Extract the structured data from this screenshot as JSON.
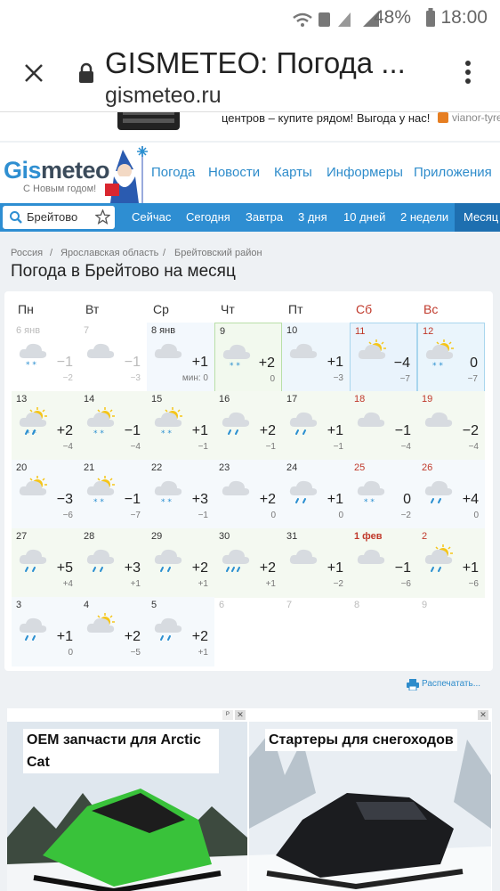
{
  "status_bar": {
    "battery": "48%",
    "time": "18:00"
  },
  "browser": {
    "title": "GISMETEO: Погода ...",
    "url": "gismeteo.ru"
  },
  "top_ad": {
    "text": "центров – купите рядом! Выгода у нас!",
    "brand": "vianor-tyre"
  },
  "header": {
    "logo_a": "Gis",
    "logo_b": "meteo",
    "logo_sub": "С Новым годом!",
    "nav": [
      "Погода",
      "Новости",
      "Карты",
      "Информеры",
      "Приложения"
    ]
  },
  "tabs": {
    "search_value": "Брейтово",
    "items": [
      "Сейчас",
      "Сегодня",
      "Завтра",
      "3 дня",
      "10 дней",
      "2 недели",
      "Месяц"
    ]
  },
  "breadcrumb": [
    "Россия",
    "Ярославская область",
    "Брейтовский район"
  ],
  "page_title": "Погода в Брейтово на месяц",
  "weekdays": [
    "Пн",
    "Вт",
    "Ср",
    "Чт",
    "Пт",
    "Сб",
    "Вс"
  ],
  "calendar": [
    {
      "date": "6 янв",
      "hi": "−1",
      "lo": "−2",
      "icon": "cloud-snow",
      "past": true
    },
    {
      "date": "7",
      "hi": "−1",
      "lo": "−3",
      "icon": "cloud",
      "past": true
    },
    {
      "date": "8 янв",
      "hi": "+1",
      "lo": "мин: 0",
      "icon": "cloud"
    },
    {
      "date": "9",
      "hi": "+2",
      "lo": "0",
      "icon": "cloud-snow"
    },
    {
      "date": "10",
      "hi": "+1",
      "lo": "−3",
      "icon": "cloud"
    },
    {
      "date": "11",
      "hi": "−4",
      "lo": "−7",
      "icon": "sun-cloud"
    },
    {
      "date": "12",
      "hi": "0",
      "lo": "−7",
      "icon": "sun-cloud-snow"
    },
    {
      "date": "13",
      "hi": "+2",
      "lo": "−4",
      "icon": "sun-cloud-snowrain"
    },
    {
      "date": "14",
      "hi": "−1",
      "lo": "−4",
      "icon": "sun-cloud-snow"
    },
    {
      "date": "15",
      "hi": "+1",
      "lo": "−1",
      "icon": "sun-cloud-snow"
    },
    {
      "date": "16",
      "hi": "+2",
      "lo": "−1",
      "icon": "cloud-rain"
    },
    {
      "date": "17",
      "hi": "+1",
      "lo": "−1",
      "icon": "cloud-rain"
    },
    {
      "date": "18",
      "hi": "−1",
      "lo": "−4",
      "icon": "cloud"
    },
    {
      "date": "19",
      "hi": "−2",
      "lo": "−4",
      "icon": "cloud"
    },
    {
      "date": "20",
      "hi": "−3",
      "lo": "−6",
      "icon": "sun-cloud"
    },
    {
      "date": "21",
      "hi": "−1",
      "lo": "−7",
      "icon": "sun-cloud-snow"
    },
    {
      "date": "22",
      "hi": "+3",
      "lo": "−1",
      "icon": "cloud-snow"
    },
    {
      "date": "23",
      "hi": "+2",
      "lo": "0",
      "icon": "cloud"
    },
    {
      "date": "24",
      "hi": "+1",
      "lo": "0",
      "icon": "cloud-rain"
    },
    {
      "date": "25",
      "hi": "0",
      "lo": "−2",
      "icon": "cloud-snow"
    },
    {
      "date": "26",
      "hi": "+4",
      "lo": "0",
      "icon": "cloud-rain"
    },
    {
      "date": "27",
      "hi": "+5",
      "lo": "+4",
      "icon": "cloud-rain"
    },
    {
      "date": "28",
      "hi": "+3",
      "lo": "+1",
      "icon": "cloud-rain"
    },
    {
      "date": "29",
      "hi": "+2",
      "lo": "+1",
      "icon": "cloud-rain"
    },
    {
      "date": "30",
      "hi": "+2",
      "lo": "+1",
      "icon": "cloud-rain2"
    },
    {
      "date": "31",
      "hi": "+1",
      "lo": "−2",
      "icon": "cloud"
    },
    {
      "date": "1 фев",
      "hi": "−1",
      "lo": "−6",
      "icon": "cloud"
    },
    {
      "date": "2",
      "hi": "+1",
      "lo": "−6",
      "icon": "sun-cloud-rain"
    },
    {
      "date": "3",
      "hi": "+1",
      "lo": "0",
      "icon": "cloud-rain"
    },
    {
      "date": "4",
      "hi": "+2",
      "lo": "−5",
      "icon": "sun-cloud"
    },
    {
      "date": "5",
      "hi": "+2",
      "lo": "+1",
      "icon": "cloud-rain"
    },
    {
      "date": "6",
      "hi": "",
      "lo": "",
      "icon": "",
      "past": true
    },
    {
      "date": "7",
      "hi": "",
      "lo": "",
      "icon": "",
      "past": true
    },
    {
      "date": "8",
      "hi": "",
      "lo": "",
      "icon": "",
      "past": true
    },
    {
      "date": "9",
      "hi": "",
      "lo": "",
      "icon": "",
      "past": true
    }
  ],
  "print_label": "Распечатать...",
  "ads": [
    {
      "title": "OEM запчасти для Arctic Cat"
    },
    {
      "title": "Стартеры для снегоходов"
    }
  ]
}
